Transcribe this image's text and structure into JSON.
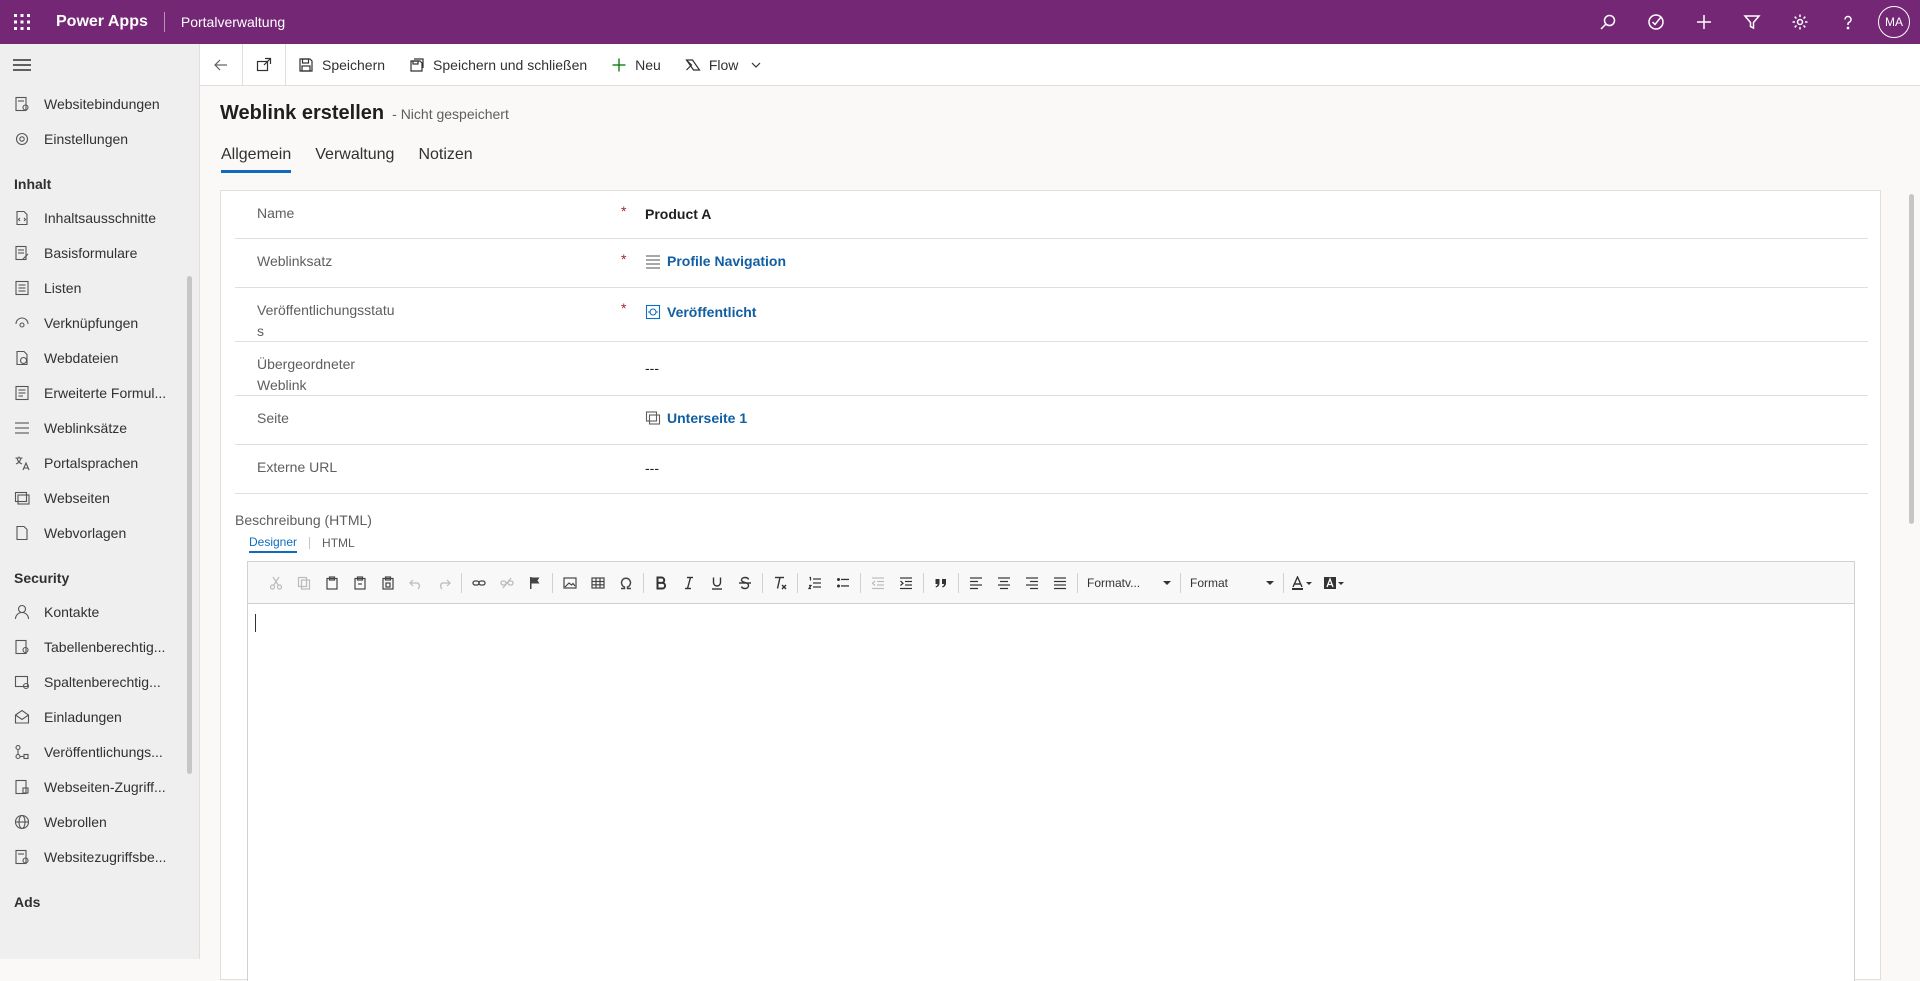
{
  "topbar": {
    "brand": "Power Apps",
    "app_title": "Portalverwaltung",
    "avatar_initials": "MA",
    "bg_color": "#742774"
  },
  "sidebar": {
    "items_top": [
      {
        "label": "Websitebindungen",
        "icon": "site-binding-icon"
      },
      {
        "label": "Einstellungen",
        "icon": "gear-icon"
      }
    ],
    "group_inhalt": "Inhalt",
    "items_inhalt": [
      {
        "label": "Inhaltsausschnitte",
        "icon": "snippet-icon"
      },
      {
        "label": "Basisformulare",
        "icon": "form-icon"
      },
      {
        "label": "Listen",
        "icon": "list-icon"
      },
      {
        "label": "Verknüpfungen",
        "icon": "shortcut-icon"
      },
      {
        "label": "Webdateien",
        "icon": "webfile-icon"
      },
      {
        "label": "Erweiterte Formul...",
        "icon": "advanced-form-icon"
      },
      {
        "label": "Weblinksätze",
        "icon": "weblink-set-icon"
      },
      {
        "label": "Portalsprachen",
        "icon": "language-icon"
      },
      {
        "label": "Webseiten",
        "icon": "webpage-icon"
      },
      {
        "label": "Webvorlagen",
        "icon": "template-icon"
      }
    ],
    "group_security": "Security",
    "items_security": [
      {
        "label": "Kontakte",
        "icon": "person-icon"
      },
      {
        "label": "Tabellenberechtig...",
        "icon": "table-permission-icon"
      },
      {
        "label": "Spaltenberechtig...",
        "icon": "column-permission-icon"
      },
      {
        "label": "Einladungen",
        "icon": "invitation-icon"
      },
      {
        "label": "Veröffentlichungs...",
        "icon": "publishing-icon"
      },
      {
        "label": "Webseiten-Zugriff...",
        "icon": "page-access-icon"
      },
      {
        "label": "Webrollen",
        "icon": "globe-icon"
      },
      {
        "label": "Websitezugriffsbe...",
        "icon": "site-access-icon"
      }
    ],
    "group_ads": "Ads"
  },
  "commandbar": {
    "save": "Speichern",
    "save_close": "Speichern und schließen",
    "new": "Neu",
    "flow": "Flow"
  },
  "form": {
    "title": "Weblink erstellen",
    "status": "- Nicht gespeichert",
    "tabs": [
      "Allgemein",
      "Verwaltung",
      "Notizen"
    ],
    "fields": {
      "name_label": "Name",
      "name_value": "Product A",
      "weblinkset_label": "Weblinksatz",
      "weblinkset_value": "Profile Navigation",
      "pubstatus_label": "Veröffentlichungsstatus",
      "pubstatus_value": "Veröffentlicht",
      "parent_label": "Übergeordneter Weblink",
      "parent_value": "---",
      "page_label": "Seite",
      "page_value": "Unterseite 1",
      "url_label": "Externe URL",
      "url_value": "---"
    },
    "required_mark": "*",
    "rich_label": "Beschreibung (HTML)",
    "rich_tabs": [
      "Designer",
      "HTML"
    ],
    "toolbar": {
      "format_style": "Formatv...",
      "format": "Format"
    }
  }
}
